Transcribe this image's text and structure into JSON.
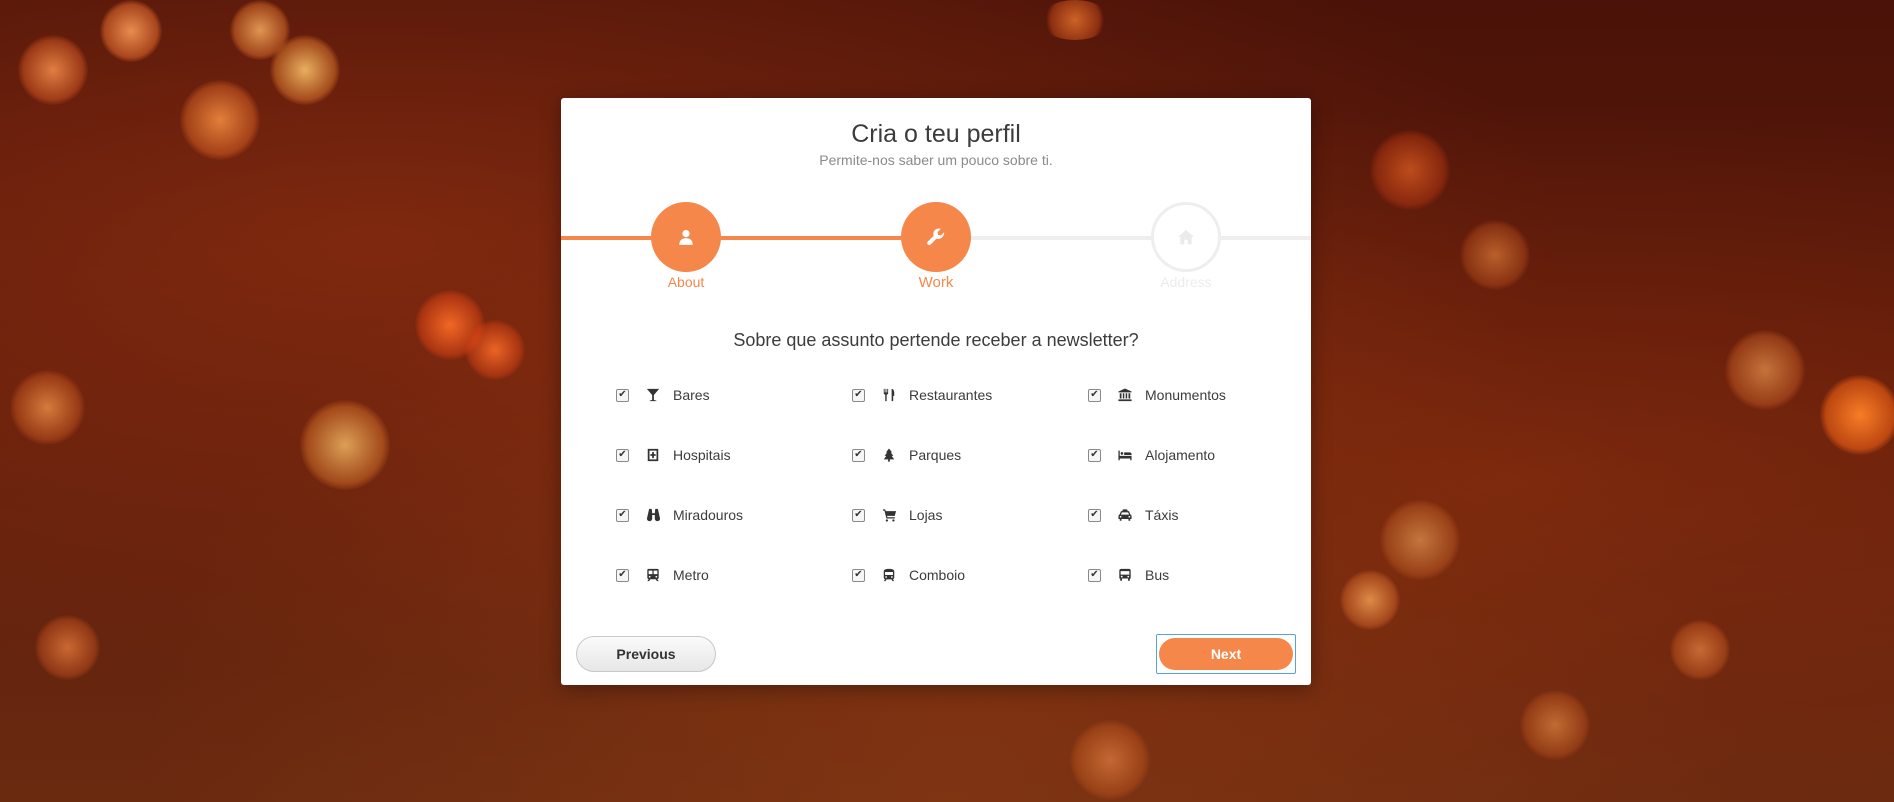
{
  "header": {
    "title": "Cria o teu perfil",
    "subtitle": "Permite-nos saber um pouco sobre ti."
  },
  "steps": [
    {
      "label": "About",
      "icon": "user-icon",
      "state": "completed"
    },
    {
      "label": "Work",
      "icon": "wrench-icon",
      "state": "active"
    },
    {
      "label": "Address",
      "icon": "home-icon",
      "state": "inactive"
    }
  ],
  "question": "Sobre que assunto pertende receber a newsletter?",
  "options": [
    {
      "label": "Bares",
      "icon": "cocktail-icon",
      "checked": true
    },
    {
      "label": "Restaurantes",
      "icon": "cutlery-icon",
      "checked": true
    },
    {
      "label": "Monumentos",
      "icon": "landmark-icon",
      "checked": true
    },
    {
      "label": "Hospitais",
      "icon": "hospital-icon",
      "checked": true
    },
    {
      "label": "Parques",
      "icon": "tree-icon",
      "checked": true
    },
    {
      "label": "Alojamento",
      "icon": "bed-icon",
      "checked": true
    },
    {
      "label": "Miradouros",
      "icon": "binoculars-icon",
      "checked": true
    },
    {
      "label": "Lojas",
      "icon": "cart-icon",
      "checked": true
    },
    {
      "label": "Táxis",
      "icon": "taxi-icon",
      "checked": true
    },
    {
      "label": "Metro",
      "icon": "subway-icon",
      "checked": true
    },
    {
      "label": "Comboio",
      "icon": "train-icon",
      "checked": true
    },
    {
      "label": "Bus",
      "icon": "bus-icon",
      "checked": true
    }
  ],
  "buttons": {
    "previous": "Previous",
    "next": "Next"
  },
  "colors": {
    "accent": "#f5874a",
    "inactive": "#eeeeee"
  }
}
